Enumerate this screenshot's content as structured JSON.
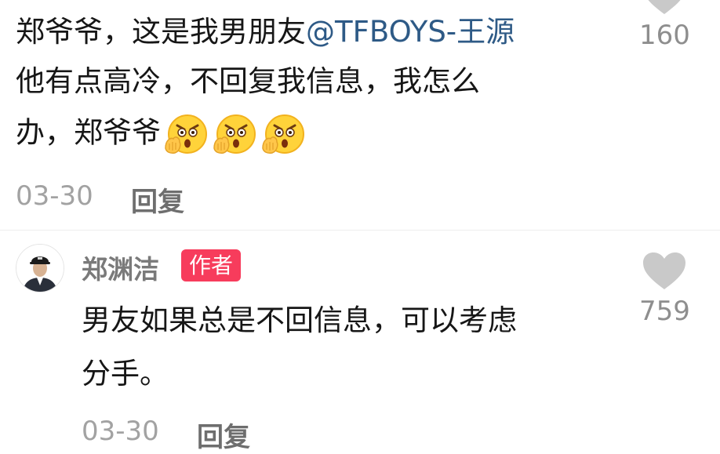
{
  "comment": {
    "line1_text": "郑爷爷，这是我男朋友",
    "mention": "@TFBOYS-王源",
    "line2": "他有点高冷，不回复我信息，我怎么",
    "line3_text": "办，郑爷爷",
    "emojis": [
      "shocked-face-emoji",
      "shocked-face-emoji",
      "shocked-face-emoji"
    ],
    "date": "03-30",
    "reply_label": "回复",
    "like_count": "160"
  },
  "reply": {
    "username": "郑渊洁",
    "badge": "作者",
    "line1": "男友如果总是不回信息，可以考虑",
    "line2": "分手。",
    "date": "03-30",
    "reply_label": "回复",
    "like_count": "759"
  },
  "colors": {
    "mention": "#2e5a86",
    "badge": "#f73c5c",
    "heart": "#c9c9c9"
  }
}
